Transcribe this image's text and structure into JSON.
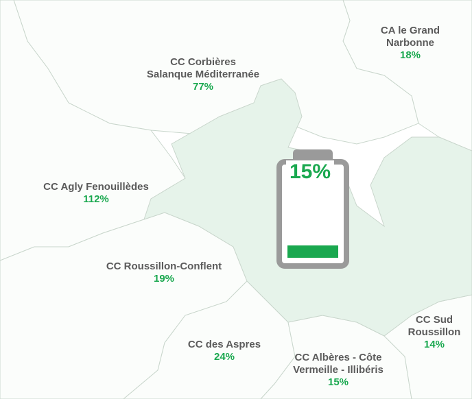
{
  "map": {
    "regions": [
      {
        "id": "corbieres",
        "name": "CC Corbières Salanque Méditerranée",
        "name_lines": [
          "CC Corbières",
          "Salanque Méditerranée"
        ],
        "value": "77%"
      },
      {
        "id": "narbonne",
        "name": "CA le Grand Narbonne",
        "name_lines": [
          "CA le Grand",
          "Narbonne"
        ],
        "value": "18%"
      },
      {
        "id": "agly",
        "name": "CC Agly Fenouillèdes",
        "name_lines": [
          "CC Agly Fenouillèdes"
        ],
        "value": "112%"
      },
      {
        "id": "conflent",
        "name": "CC Roussillon-Conflent",
        "name_lines": [
          "CC Roussillon-Conflent"
        ],
        "value": "19%"
      },
      {
        "id": "aspres",
        "name": "CC des Aspres",
        "name_lines": [
          "CC des Aspres"
        ],
        "value": "24%"
      },
      {
        "id": "alberes",
        "name": "CC Albères - Côte Vermeille - Illibéris",
        "name_lines": [
          "CC Albères - Côte",
          "Vermeille - Illibéris"
        ],
        "value": "15%"
      },
      {
        "id": "sud",
        "name": "CC Sud Roussillon",
        "name_lines": [
          "CC Sud",
          "Roussillon"
        ],
        "value": "14%"
      }
    ],
    "highlighted_region": {
      "value": "15%",
      "fill_level_percent": 15
    }
  },
  "colors": {
    "accent_green": "#1aa84f",
    "label_gray": "#5b5b5b",
    "battery_gray": "#9a9a9a",
    "highlight_fill": "#e6f3ea",
    "region_fill": "#fbfdfb",
    "border": "#c9d6cc"
  },
  "icons": {
    "battery": "battery-icon"
  }
}
